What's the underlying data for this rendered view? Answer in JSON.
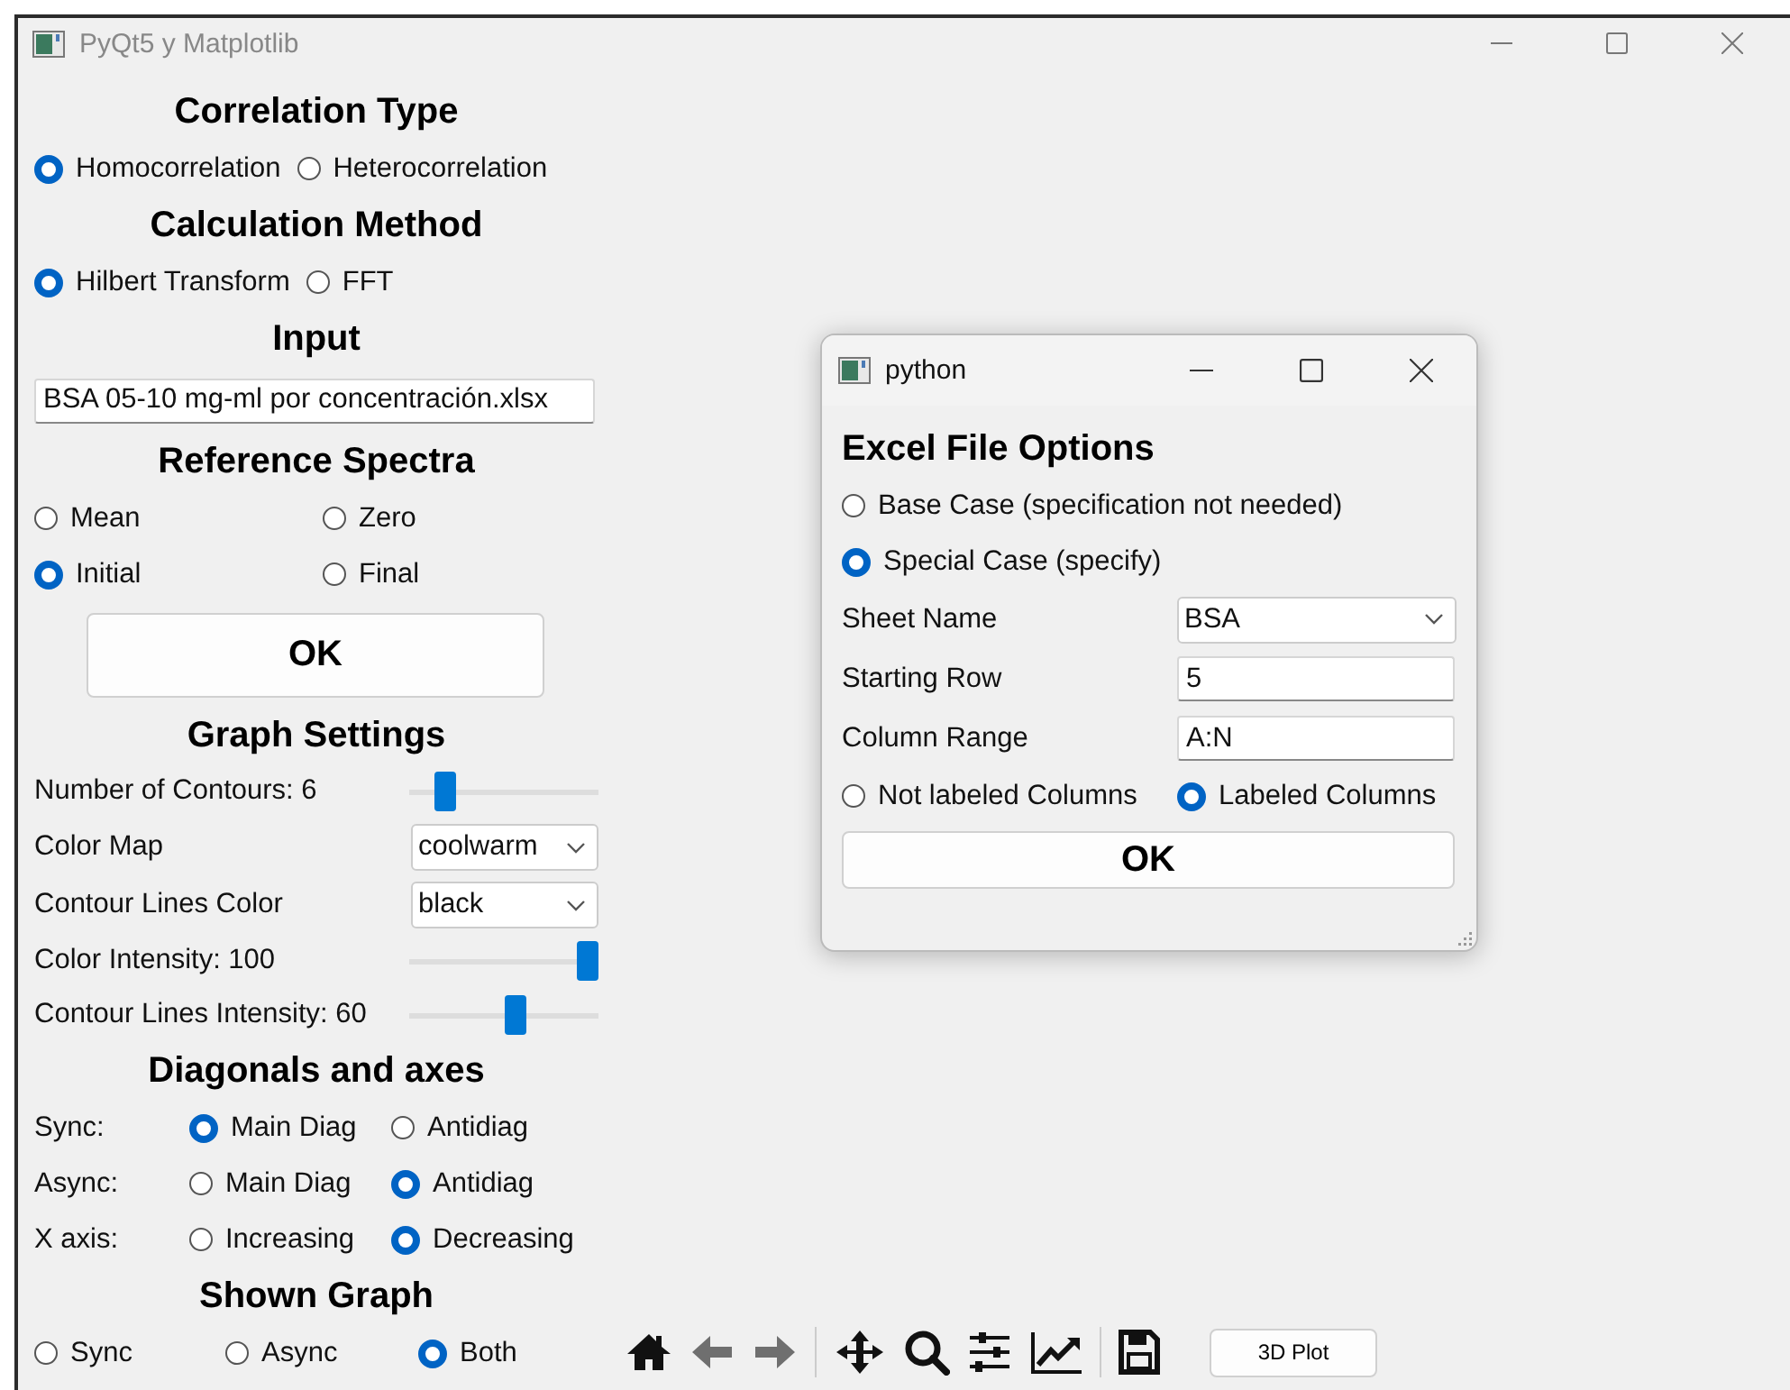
{
  "window": {
    "title": "PyQt5 y Matplotlib"
  },
  "panel": [
    {
      "kind": "heading",
      "text": "Correlation Type"
    },
    {
      "kind": "radios",
      "options": [
        {
          "label": "Homocorrelation",
          "selected": true
        },
        {
          "label": "Heterocorrelation",
          "selected": false
        }
      ]
    },
    {
      "kind": "heading",
      "text": "Calculation Method"
    },
    {
      "kind": "radios",
      "options": [
        {
          "label": "Hilbert Transform",
          "selected": true
        },
        {
          "label": "FFT",
          "selected": false
        }
      ]
    },
    {
      "kind": "heading",
      "text": "Input"
    },
    {
      "kind": "input",
      "value": "BSA 05-10 mg-ml por concentración.xlsx"
    },
    {
      "kind": "heading",
      "text": "Reference Spectra"
    },
    {
      "kind": "radio_grid",
      "options": [
        {
          "label": "Mean",
          "selected": false
        },
        {
          "label": "Zero",
          "selected": false
        },
        {
          "label": "Initial",
          "selected": true
        },
        {
          "label": "Final",
          "selected": false
        }
      ]
    },
    {
      "kind": "button",
      "label": "OK"
    },
    {
      "kind": "heading",
      "text": "Graph Settings"
    },
    {
      "kind": "slider",
      "label": "Number of Contours: 6",
      "level": 0.15
    },
    {
      "kind": "select",
      "label": "Color Map",
      "value": "coolwarm"
    },
    {
      "kind": "select",
      "label": "Contour Lines Color",
      "value": "black"
    },
    {
      "kind": "slider",
      "label": "Color Intensity: 100",
      "level": 1
    },
    {
      "kind": "slider",
      "label": "Contour Lines Intensity: 60",
      "level": 0.57
    },
    {
      "kind": "heading",
      "text": "Diagonals and axes"
    },
    {
      "kind": "labeled_radios",
      "label": "Sync:",
      "options": [
        {
          "label": "Main Diag",
          "selected": true
        },
        {
          "label": "Antidiag",
          "selected": false
        }
      ]
    },
    {
      "kind": "labeled_radios",
      "label": "Async:",
      "options": [
        {
          "label": "Main Diag",
          "selected": false
        },
        {
          "label": "Antidiag",
          "selected": true
        }
      ]
    },
    {
      "kind": "labeled_radios",
      "label": "X axis:",
      "options": [
        {
          "label": "Increasing",
          "selected": false
        },
        {
          "label": "Decreasing",
          "selected": true
        }
      ]
    },
    {
      "kind": "heading",
      "text": "Shown Graph"
    },
    {
      "kind": "radio_spread",
      "options": [
        {
          "label": "Sync",
          "selected": false
        },
        {
          "label": "Async",
          "selected": false
        },
        {
          "label": "Both",
          "selected": true
        }
      ]
    }
  ],
  "toolbar": {
    "tools": [
      {
        "kind": "home",
        "disabled": false
      },
      {
        "kind": "back",
        "disabled": true
      },
      {
        "kind": "forward",
        "disabled": true
      },
      {
        "kind": "separator"
      },
      {
        "kind": "pan",
        "disabled": false
      },
      {
        "kind": "zoom",
        "disabled": false
      },
      {
        "kind": "configure",
        "disabled": false
      },
      {
        "kind": "edit",
        "disabled": false
      },
      {
        "kind": "separator"
      },
      {
        "kind": "save",
        "disabled": false
      }
    ],
    "button": "3D Plot"
  },
  "dialog": {
    "title": "python",
    "heading": "Excel File Options",
    "rows": [
      {
        "kind": "radio",
        "label": "Base Case (specification not needed)",
        "selected": false
      },
      {
        "kind": "radio",
        "label": "Special Case (specify)",
        "selected": true
      },
      {
        "kind": "select",
        "label": "Sheet Name",
        "value": "BSA"
      },
      {
        "kind": "input",
        "label": "Starting Row",
        "value": "5"
      },
      {
        "kind": "input",
        "label": "Column Range",
        "value": "A:N"
      },
      {
        "kind": "radios",
        "options": [
          {
            "label": "Not labeled Columns",
            "selected": false
          },
          {
            "label": "Labeled Columns",
            "selected": true
          }
        ]
      },
      {
        "kind": "button",
        "label": "OK"
      }
    ]
  }
}
